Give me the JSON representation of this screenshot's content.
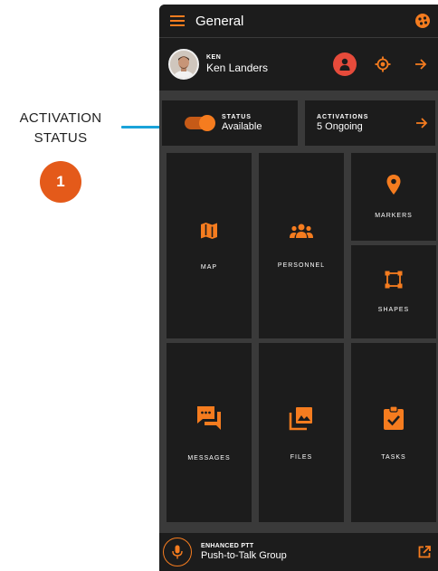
{
  "annotation": {
    "label_line1": "ACTIVATION",
    "label_line2": "STATUS",
    "badge": "1"
  },
  "app_bar": {
    "title": "General",
    "menu_icon": "hamburger-menu-icon",
    "right_icon": "palette-icon"
  },
  "user": {
    "small_label": "KEN",
    "full_name": "Ken Landers"
  },
  "status": {
    "label": "STATUS",
    "value": "Available",
    "toggle_on": true
  },
  "activations": {
    "label": "ACTIVATIONS",
    "value": "5 Ongoing"
  },
  "tiles": {
    "map": "MAP",
    "personnel": "PERSONNEL",
    "markers": "MARKERS",
    "shapes": "SHAPES",
    "messages": "MESSAGES",
    "files": "FILES",
    "tasks": "TASKS"
  },
  "ptt": {
    "label": "ENHANCED PTT",
    "group": "Push-to-Talk Group"
  },
  "colors": {
    "accent": "#f57c1f",
    "callout_line": "#1aa3d9",
    "badge": "#e45a1a",
    "alert_red": "#e64b3b",
    "panel": "#1c1c1c",
    "background": "#3a3a3a"
  }
}
